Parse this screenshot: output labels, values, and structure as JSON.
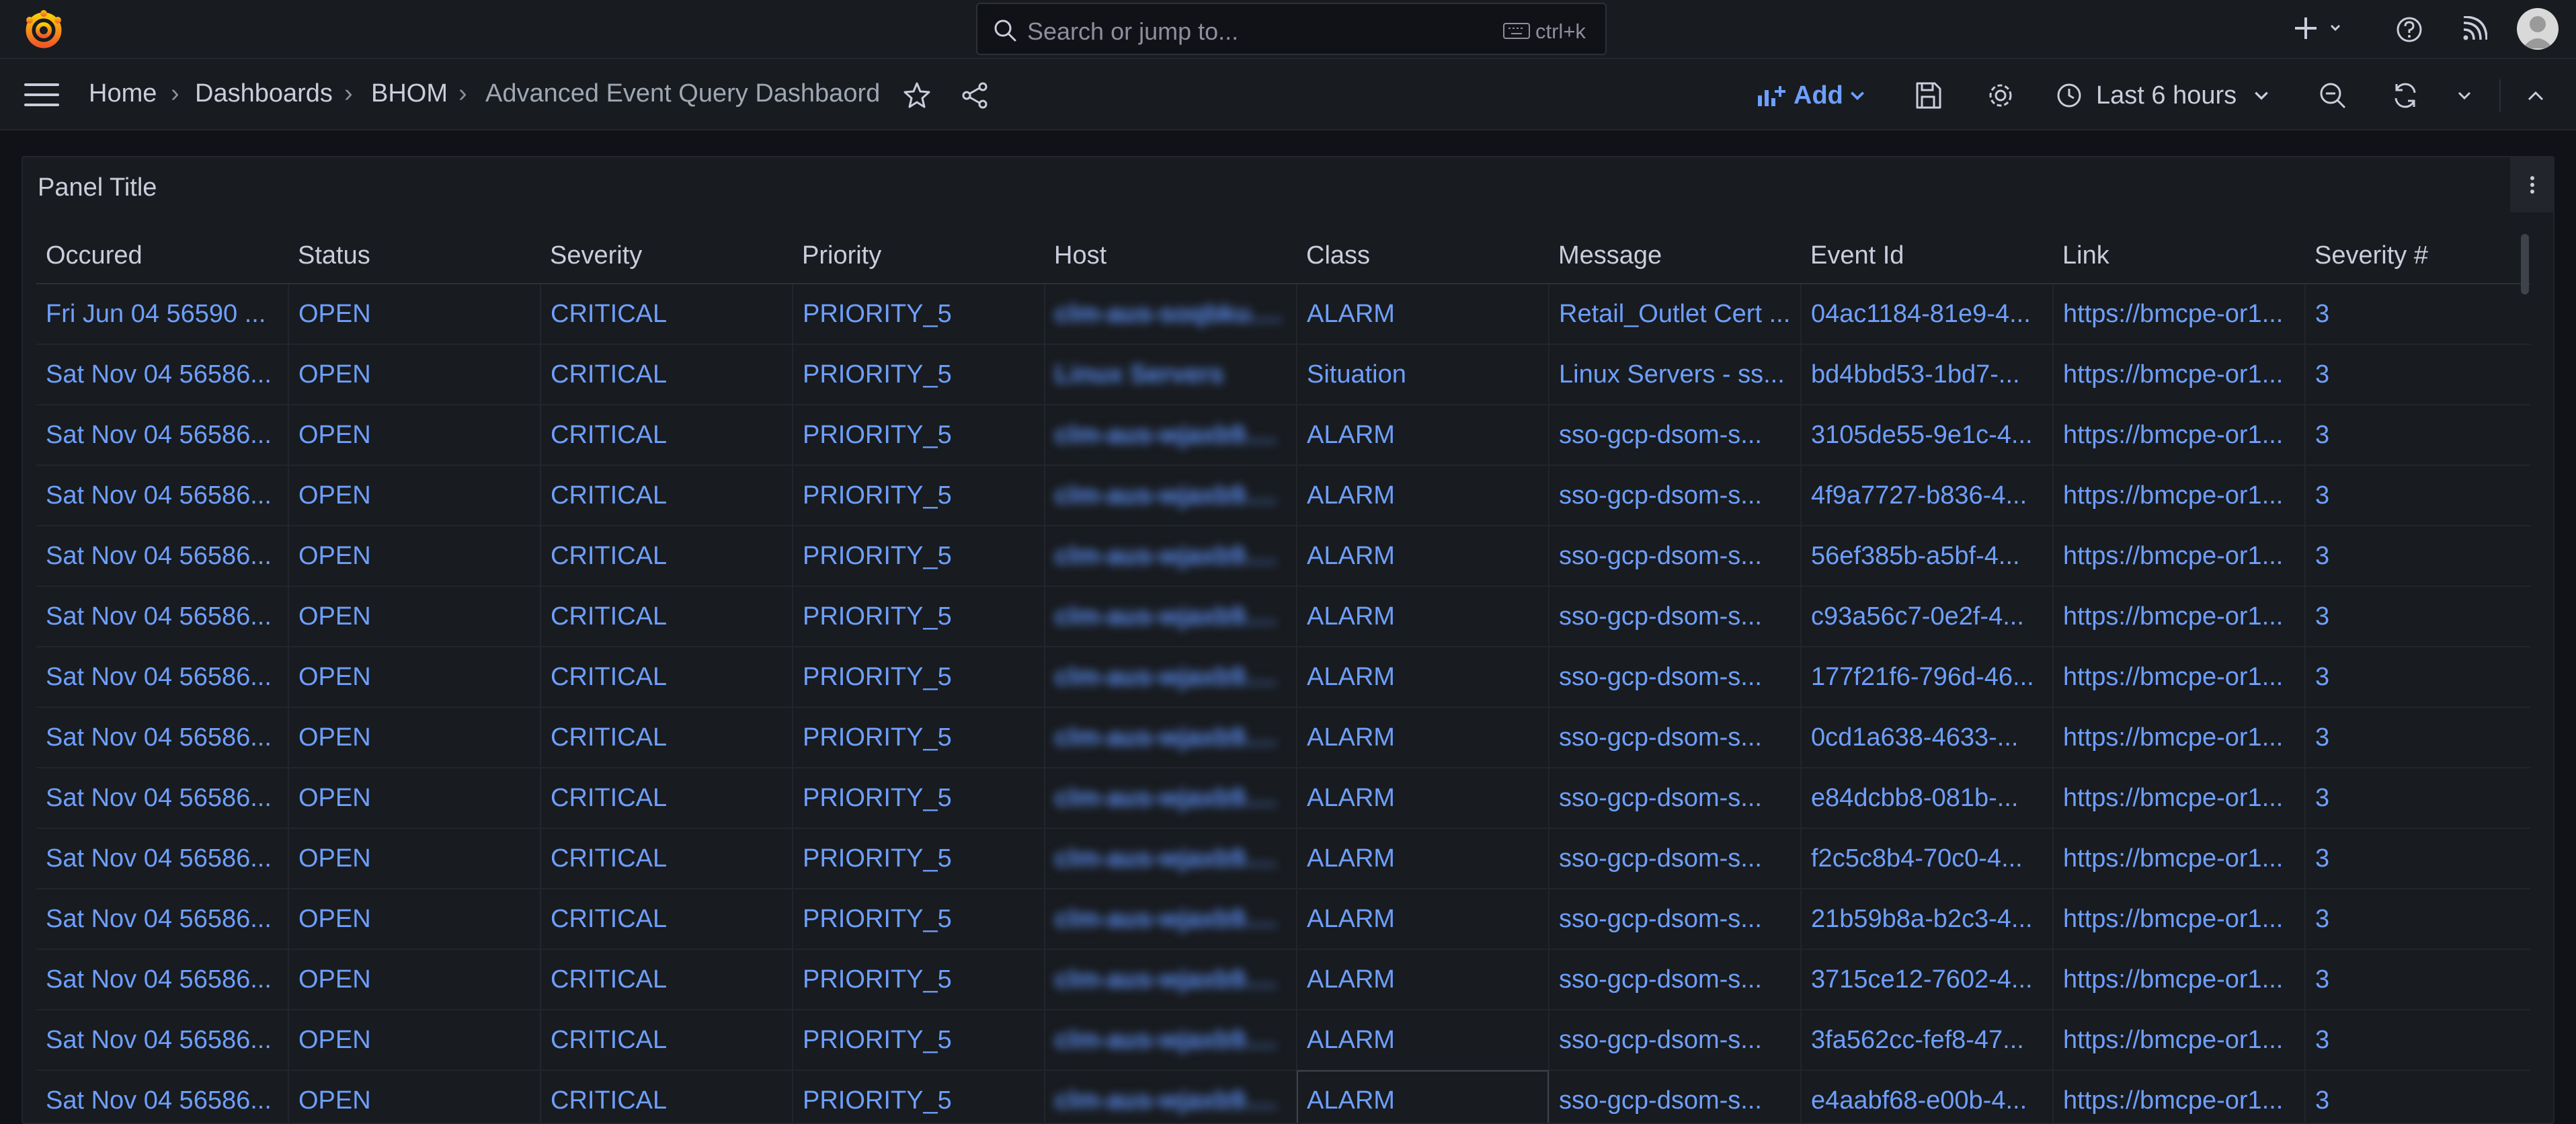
{
  "search": {
    "placeholder": "Search or jump to...",
    "shortcut": "ctrl+k"
  },
  "breadcrumbs": [
    "Home",
    "Dashboards",
    "BHOM",
    "Advanced Event Query Dashbaord"
  ],
  "toolbar": {
    "add_label": "Add",
    "time_range": "Last 6 hours"
  },
  "panel": {
    "title": "Panel Title",
    "columns": [
      "Occured",
      "Status",
      "Severity",
      "Priority",
      "Host",
      "Class",
      "Message",
      "Event Id",
      "Link",
      "Severity #"
    ],
    "rows": [
      [
        "Fri Jun 04 56590 ...",
        "OPEN",
        "CRITICAL",
        "PRIORITY_5",
        "clm-aus-soqbku.b...",
        "ALARM",
        "Retail_Outlet Cert ...",
        "04ac1184-81e9-4...",
        "https://bmcpe-or1...",
        "3"
      ],
      [
        "Sat Nov 04 56586...",
        "OPEN",
        "CRITICAL",
        "PRIORITY_5",
        "Linux Servers",
        "Situation",
        "Linux Servers - ss...",
        "bd4bbd53-1bd7-...",
        "https://bmcpe-or1...",
        "3"
      ],
      [
        "Sat Nov 04 56586...",
        "OPEN",
        "CRITICAL",
        "PRIORITY_5",
        "clm-aus-wjaxb9.b...",
        "ALARM",
        "sso-gcp-dsom-s...",
        "3105de55-9e1c-4...",
        "https://bmcpe-or1...",
        "3"
      ],
      [
        "Sat Nov 04 56586...",
        "OPEN",
        "CRITICAL",
        "PRIORITY_5",
        "clm-aus-wjaxb9.b...",
        "ALARM",
        "sso-gcp-dsom-s...",
        "4f9a7727-b836-4...",
        "https://bmcpe-or1...",
        "3"
      ],
      [
        "Sat Nov 04 56586...",
        "OPEN",
        "CRITICAL",
        "PRIORITY_5",
        "clm-aus-wjaxb9.b...",
        "ALARM",
        "sso-gcp-dsom-s...",
        "56ef385b-a5bf-4...",
        "https://bmcpe-or1...",
        "3"
      ],
      [
        "Sat Nov 04 56586...",
        "OPEN",
        "CRITICAL",
        "PRIORITY_5",
        "clm-aus-wjaxb9.b...",
        "ALARM",
        "sso-gcp-dsom-s...",
        "c93a56c7-0e2f-4...",
        "https://bmcpe-or1...",
        "3"
      ],
      [
        "Sat Nov 04 56586...",
        "OPEN",
        "CRITICAL",
        "PRIORITY_5",
        "clm-aus-wjaxb9.b...",
        "ALARM",
        "sso-gcp-dsom-s...",
        "177f21f6-796d-46...",
        "https://bmcpe-or1...",
        "3"
      ],
      [
        "Sat Nov 04 56586...",
        "OPEN",
        "CRITICAL",
        "PRIORITY_5",
        "clm-aus-wjaxb9.b...",
        "ALARM",
        "sso-gcp-dsom-s...",
        "0cd1a638-4633-...",
        "https://bmcpe-or1...",
        "3"
      ],
      [
        "Sat Nov 04 56586...",
        "OPEN",
        "CRITICAL",
        "PRIORITY_5",
        "clm-aus-wjaxb9.b...",
        "ALARM",
        "sso-gcp-dsom-s...",
        "e84dcbb8-081b-...",
        "https://bmcpe-or1...",
        "3"
      ],
      [
        "Sat Nov 04 56586...",
        "OPEN",
        "CRITICAL",
        "PRIORITY_5",
        "clm-aus-wjaxb9.b...",
        "ALARM",
        "sso-gcp-dsom-s...",
        "f2c5c8b4-70c0-4...",
        "https://bmcpe-or1...",
        "3"
      ],
      [
        "Sat Nov 04 56586...",
        "OPEN",
        "CRITICAL",
        "PRIORITY_5",
        "clm-aus-wjaxb9.b...",
        "ALARM",
        "sso-gcp-dsom-s...",
        "21b59b8a-b2c3-4...",
        "https://bmcpe-or1...",
        "3"
      ],
      [
        "Sat Nov 04 56586...",
        "OPEN",
        "CRITICAL",
        "PRIORITY_5",
        "clm-aus-wjaxb9.b...",
        "ALARM",
        "sso-gcp-dsom-s...",
        "3715ce12-7602-4...",
        "https://bmcpe-or1...",
        "3"
      ],
      [
        "Sat Nov 04 56586...",
        "OPEN",
        "CRITICAL",
        "PRIORITY_5",
        "clm-aus-wjaxb9.b...",
        "ALARM",
        "sso-gcp-dsom-s...",
        "3fa562cc-fef8-47...",
        "https://bmcpe-or1...",
        "3"
      ],
      [
        "Sat Nov 04 56586...",
        "OPEN",
        "CRITICAL",
        "PRIORITY_5",
        "clm-aus-wjaxb9.b...",
        "ALARM",
        "sso-gcp-dsom-s...",
        "e4aabf68-e00b-4...",
        "https://bmcpe-or1...",
        "3"
      ]
    ]
  },
  "colors": {
    "background": "#111217",
    "surface": "#181b1f",
    "link": "#6e9fff",
    "logo": "#f46800",
    "text": "#ccccdc"
  }
}
